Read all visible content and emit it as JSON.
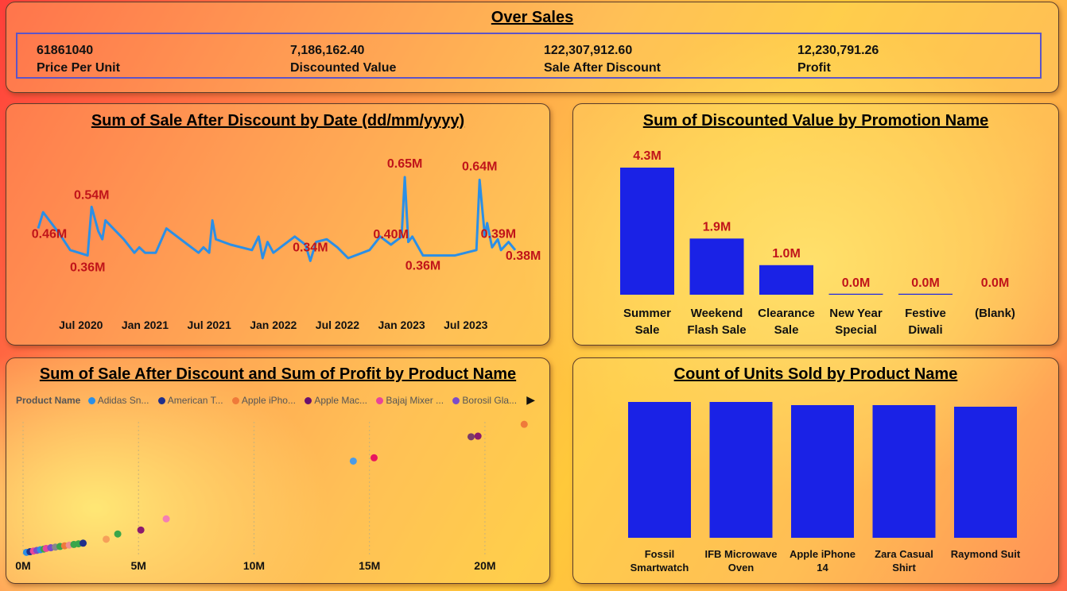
{
  "header": {
    "title": "Over Sales",
    "kpis": [
      {
        "value": "61861040",
        "label": "Price Per Unit"
      },
      {
        "value": "7,186,162.40",
        "label": "Discounted Value"
      },
      {
        "value": "122,307,912.60",
        "label": "Sale After Discount"
      },
      {
        "value": "12,230,791.26",
        "label": "Profit"
      }
    ]
  },
  "colors": {
    "bar": "#1a22e6",
    "line": "#2b8fe6",
    "data_label": "#c0141a"
  },
  "line_chart": {
    "title": "Sum of Sale After Discount by Date (dd/mm/yyyy)",
    "chart_data": {
      "type": "line",
      "title": "Sum of Sale After Discount by Date (dd/mm/yyyy)",
      "x_ticks": [
        "Jul 2020",
        "Jan 2021",
        "Jul 2021",
        "Jan 2022",
        "Jul 2022",
        "Jan 2023",
        "Jul 2023"
      ],
      "ylim": [
        0.2,
        0.7
      ],
      "points": [
        {
          "x": "2020-03",
          "y": 0.46
        },
        {
          "x": "2020-03-15",
          "y": 0.52
        },
        {
          "x": "2020-05",
          "y": 0.44
        },
        {
          "x": "2020-06",
          "y": 0.38
        },
        {
          "x": "2020-07-20",
          "y": 0.36
        },
        {
          "x": "2020-08",
          "y": 0.54
        },
        {
          "x": "2020-08-20",
          "y": 0.45
        },
        {
          "x": "2020-09",
          "y": 0.42
        },
        {
          "x": "2020-09-10",
          "y": 0.49
        },
        {
          "x": "2020-11",
          "y": 0.42
        },
        {
          "x": "2020-12",
          "y": 0.37
        },
        {
          "x": "2020-12-15",
          "y": 0.39
        },
        {
          "x": "2021-01",
          "y": 0.37
        },
        {
          "x": "2021-02",
          "y": 0.37
        },
        {
          "x": "2021-03",
          "y": 0.46
        },
        {
          "x": "2021-04",
          "y": 0.43
        },
        {
          "x": "2021-05",
          "y": 0.4
        },
        {
          "x": "2021-06",
          "y": 0.37
        },
        {
          "x": "2021-06-15",
          "y": 0.39
        },
        {
          "x": "2021-07",
          "y": 0.37
        },
        {
          "x": "2021-07-10",
          "y": 0.49
        },
        {
          "x": "2021-07-20",
          "y": 0.42
        },
        {
          "x": "2021-09",
          "y": 0.4
        },
        {
          "x": "2021-11",
          "y": 0.38
        },
        {
          "x": "2021-11-20",
          "y": 0.43
        },
        {
          "x": "2021-12",
          "y": 0.35
        },
        {
          "x": "2021-12-15",
          "y": 0.41
        },
        {
          "x": "2022-01",
          "y": 0.37
        },
        {
          "x": "2022-03",
          "y": 0.43
        },
        {
          "x": "2022-04",
          "y": 0.4
        },
        {
          "x": "2022-04-15",
          "y": 0.34
        },
        {
          "x": "2022-05",
          "y": 0.41
        },
        {
          "x": "2022-06",
          "y": 0.42
        },
        {
          "x": "2022-07",
          "y": 0.39
        },
        {
          "x": "2022-08",
          "y": 0.35
        },
        {
          "x": "2022-10",
          "y": 0.38
        },
        {
          "x": "2022-11",
          "y": 0.43
        },
        {
          "x": "2022-12",
          "y": 0.4
        },
        {
          "x": "2023-01",
          "y": 0.43
        },
        {
          "x": "2023-01-10",
          "y": 0.65
        },
        {
          "x": "2023-01-20",
          "y": 0.41
        },
        {
          "x": "2023-02",
          "y": 0.43
        },
        {
          "x": "2023-03",
          "y": 0.36
        },
        {
          "x": "2023-06",
          "y": 0.36
        },
        {
          "x": "2023-08",
          "y": 0.38
        },
        {
          "x": "2023-08-10",
          "y": 0.64
        },
        {
          "x": "2023-08-25",
          "y": 0.43
        },
        {
          "x": "2023-09",
          "y": 0.48
        },
        {
          "x": "2023-09-15",
          "y": 0.39
        },
        {
          "x": "2023-10",
          "y": 0.42
        },
        {
          "x": "2023-10-10",
          "y": 0.38
        },
        {
          "x": "2023-11",
          "y": 0.41
        },
        {
          "x": "2023-11-20",
          "y": 0.38
        }
      ],
      "data_labels": [
        {
          "text": "0.46M",
          "x": "2020-03",
          "y": 0.46
        },
        {
          "text": "0.54M",
          "x": "2020-08",
          "y": 0.54
        },
        {
          "text": "0.36M",
          "x": "2020-07-20",
          "y": 0.36
        },
        {
          "text": "0.34M",
          "x": "2022-04-15",
          "y": 0.34
        },
        {
          "text": "0.40M",
          "x": "2022-12",
          "y": 0.4
        },
        {
          "text": "0.65M",
          "x": "2023-01-10",
          "y": 0.65
        },
        {
          "text": "0.36M",
          "x": "2023-03",
          "y": 0.36
        },
        {
          "text": "0.64M",
          "x": "2023-08-10",
          "y": 0.64
        },
        {
          "text": "0.39M",
          "x": "2023-09-15",
          "y": 0.39
        },
        {
          "text": "0.38M",
          "x": "2023-10-10",
          "y": 0.38
        }
      ]
    }
  },
  "promo_chart": {
    "title": "Sum of Discounted Value by Promotion Name",
    "chart_data": {
      "type": "bar",
      "title": "Sum of Discounted Value by Promotion Name",
      "categories": [
        [
          "Summer",
          "Sale"
        ],
        [
          "Weekend",
          "Flash Sale"
        ],
        [
          "Clearance",
          "Sale"
        ],
        [
          "New Year",
          "Special"
        ],
        [
          "Festive",
          "Diwali"
        ],
        [
          "(Blank)"
        ]
      ],
      "values": [
        4.3,
        1.9,
        1.0,
        0.0,
        0.0,
        0.0
      ],
      "labels": [
        "4.3M",
        "1.9M",
        "1.0M",
        "0.0M",
        "0.0M",
        "0.0M"
      ],
      "ylim": [
        0,
        4.3
      ]
    }
  },
  "scatter_chart": {
    "title": "Sum of Sale After Discount and Sum of Profit by Product Name",
    "legend_title": "Product Name",
    "legend_items": [
      {
        "name": "Adidas Sn...",
        "color": "#2b8fe6"
      },
      {
        "name": "American T...",
        "color": "#1f2f8c"
      },
      {
        "name": "Apple iPho...",
        "color": "#ef7a3a"
      },
      {
        "name": "Apple Mac...",
        "color": "#6a0f6e"
      },
      {
        "name": "Bajaj Mixer ...",
        "color": "#e8459a"
      },
      {
        "name": "Borosil Gla...",
        "color": "#7b4cc8"
      }
    ],
    "legend_next": "▶",
    "chart_data": {
      "type": "scatter",
      "title": "Sum of Sale After Discount and Sum of Profit by Product Name",
      "x_ticks": [
        "0M",
        "5M",
        "10M",
        "15M",
        "20M"
      ],
      "xlim": [
        0,
        22
      ],
      "ylim": [
        0,
        2.25
      ],
      "points": [
        {
          "x": 0.15,
          "y": 0.02,
          "color": "#2b8fe6"
        },
        {
          "x": 0.3,
          "y": 0.03,
          "color": "#1f2f8c"
        },
        {
          "x": 0.45,
          "y": 0.04,
          "color": "#e8459a"
        },
        {
          "x": 0.6,
          "y": 0.05,
          "color": "#7b4cc8"
        },
        {
          "x": 0.75,
          "y": 0.06,
          "color": "#2b8fe6"
        },
        {
          "x": 0.9,
          "y": 0.07,
          "color": "#3aa64a"
        },
        {
          "x": 1.0,
          "y": 0.08,
          "color": "#e8459a"
        },
        {
          "x": 1.2,
          "y": 0.09,
          "color": "#7b4cc8"
        },
        {
          "x": 1.4,
          "y": 0.1,
          "color": "#888888"
        },
        {
          "x": 1.6,
          "y": 0.11,
          "color": "#3aa64a"
        },
        {
          "x": 1.8,
          "y": 0.12,
          "color": "#ef7a3a"
        },
        {
          "x": 2.0,
          "y": 0.13,
          "color": "#ef8f8f"
        },
        {
          "x": 2.2,
          "y": 0.14,
          "color": "#3aa64a"
        },
        {
          "x": 2.4,
          "y": 0.15,
          "color": "#3aa64a"
        },
        {
          "x": 2.6,
          "y": 0.16,
          "color": "#1f2f8c"
        },
        {
          "x": 3.6,
          "y": 0.22,
          "color": "#f6a05a"
        },
        {
          "x": 4.1,
          "y": 0.3,
          "color": "#3aa64a"
        },
        {
          "x": 5.1,
          "y": 0.36,
          "color": "#8b1a6e"
        },
        {
          "x": 6.2,
          "y": 0.53,
          "color": "#f47fb4"
        },
        {
          "x": 14.3,
          "y": 1.41,
          "color": "#4a9be8"
        },
        {
          "x": 15.2,
          "y": 1.46,
          "color": "#e8155f"
        },
        {
          "x": 19.4,
          "y": 1.78,
          "color": "#7a3a6a"
        },
        {
          "x": 19.7,
          "y": 1.79,
          "color": "#8b1a6e"
        },
        {
          "x": 21.7,
          "y": 1.97,
          "color": "#ef7a3a"
        }
      ]
    }
  },
  "units_chart": {
    "title": "Count of Units Sold by Product Name",
    "chart_data": {
      "type": "bar",
      "title": "Count of Units Sold by Product Name",
      "categories": [
        [
          "Fossil",
          "Smartwatch"
        ],
        [
          "IFB Microwave",
          "Oven"
        ],
        [
          "Apple iPhone",
          "14"
        ],
        [
          "Zara Casual",
          "Shirt"
        ],
        [
          "Raymond Suit"
        ]
      ],
      "values": [
        171,
        171,
        167,
        167,
        165
      ],
      "ylim": [
        0,
        171
      ]
    }
  }
}
